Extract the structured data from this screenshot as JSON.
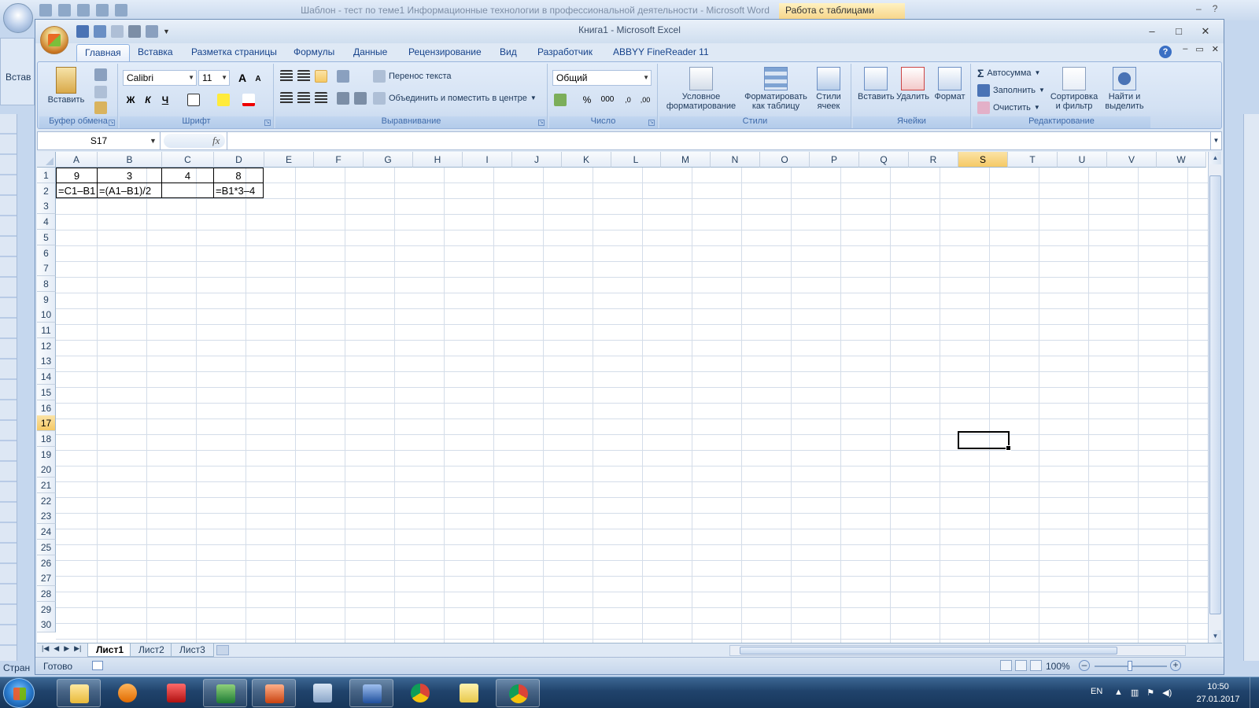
{
  "word": {
    "title": "Шаблон - тест по теме1 Информационные технологии в профессиональной деятельности - Microsoft Word",
    "context_tab": "Работа с таблицами",
    "paste_label": "Встав",
    "status_label": "Стран"
  },
  "excel": {
    "title": "Книга1 - Microsoft Excel",
    "window_controls": [
      "–",
      "□",
      "✕"
    ],
    "doc_controls": [
      "–",
      "▭",
      "✕"
    ]
  },
  "ribbon_tabs": [
    "Главная",
    "Вставка",
    "Разметка страницы",
    "Формулы",
    "Данные",
    "Рецензирование",
    "Вид",
    "Разработчик",
    "ABBYY FineReader 11"
  ],
  "ribbon": {
    "clipboard": {
      "label": "Буфер обмена",
      "paste": "Вставить"
    },
    "font": {
      "label": "Шрифт",
      "font_name": "Calibri",
      "font_size": "11",
      "bold": "Ж",
      "italic": "К",
      "underline": "Ч",
      "grow": "A",
      "shrink": "A"
    },
    "alignment": {
      "label": "Выравнивание",
      "wrap_text": "Перенос текста",
      "merge_center": "Объединить и поместить в центре"
    },
    "number": {
      "label": "Число",
      "format": "Общий",
      "percent": "%",
      "thousands": "000",
      "inc_decimal": ",0",
      "dec_decimal": ",00"
    },
    "styles": {
      "label": "Стили",
      "conditional": "Условное форматирование",
      "format_table": "Форматировать как таблицу",
      "cell_styles": "Стили ячеек"
    },
    "cells": {
      "label": "Ячейки",
      "insert": "Вставить",
      "delete": "Удалить",
      "format": "Формат"
    },
    "editing": {
      "label": "Редактирование",
      "autosum": "Автосумма",
      "fill": "Заполнить",
      "clear": "Очистить",
      "sort_filter": "Сортировка и фильтр",
      "find_select": "Найти и выделить"
    }
  },
  "formula_bar": {
    "name_box": "S17",
    "fx": "fx",
    "formula": ""
  },
  "columns": [
    "A",
    "B",
    "C",
    "D",
    "E",
    "F",
    "G",
    "H",
    "I",
    "J",
    "K",
    "L",
    "M",
    "N",
    "O",
    "P",
    "Q",
    "R",
    "S",
    "T",
    "U",
    "V",
    "W"
  ],
  "rows": [
    "1",
    "2",
    "3",
    "4",
    "5",
    "6",
    "7",
    "8",
    "9",
    "10",
    "11",
    "12",
    "13",
    "14",
    "15",
    "16",
    "17",
    "18",
    "19",
    "20",
    "21",
    "22",
    "23",
    "24",
    "25",
    "26",
    "27",
    "28",
    "29",
    "30"
  ],
  "selected_column": "S",
  "selected_row": "17",
  "cells": {
    "A1": "9",
    "B1": "3",
    "C1": "4",
    "D1": "8",
    "A2": "=C1–B1",
    "B2": "=(A1–B1)/2",
    "C2": "",
    "D2": "=B1*3–4"
  },
  "sheets": [
    "Лист1",
    "Лист2",
    "Лист3"
  ],
  "active_sheet": "Лист1",
  "status": {
    "ready": "Готово",
    "zoom": "100%",
    "zoom_out": "–",
    "zoom_in": "+"
  },
  "taskbar": {
    "apps": [
      "explorer",
      "media-player",
      "winrar",
      "excel",
      "powerpoint",
      "calculator",
      "word",
      "chrome",
      "folder",
      "chrome-user"
    ],
    "language": "EN",
    "time": "10:50",
    "date": "27.01.2017"
  }
}
